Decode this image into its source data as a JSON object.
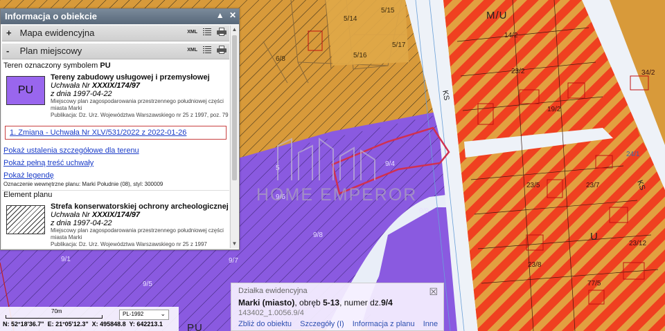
{
  "panel": {
    "title": "Informacja o obiekcie",
    "collapse_glyph": "▲",
    "close_glyph": "✕",
    "sections": [
      {
        "sign": "+",
        "label": "Mapa ewidencyjna",
        "xml": "XML"
      },
      {
        "sign": "-",
        "label": "Plan miejscowy",
        "xml": "XML"
      }
    ],
    "area_symbol_text": "Teren oznaczony symbolem",
    "area_symbol": "PU",
    "entry1": {
      "symbol": "PU",
      "title": "Tereny zabudowy usługowej i przemysłowej",
      "resolution_prefix": "Uchwała Nr",
      "resolution_no": "XXXIX/174/97",
      "date": "z dnia 1997-04-22",
      "desc": "Miejscowy plan zagospodarowania przestrzennego południowej części miasta Marki",
      "pub": "Publikacja: Dz. Urz. Województwa Warszawskiego nr 25 z 1997, poz. 79"
    },
    "change_link": "1. Zmiana - Uchwała Nr XLV/531/2022 z 2022-01-26",
    "links": [
      "Pokaż ustalenia szczegółowe dla terenu",
      "Pokaż pełną treść uchwały",
      "Pokaż legendę"
    ],
    "internal_designation": "Oznaczenie wewnętrzne planu: Marki Południe (08), styl: 300009",
    "element_heading": "Element planu",
    "entry2": {
      "title": "Strefa konserwatorskiej ochrony archeologicznej",
      "resolution_prefix": "Uchwała Nr",
      "resolution_no": "XXXIX/174/97",
      "date": "z dnia 1997-04-22",
      "desc": "Miejscowy plan zagospodarowania przestrzennego południowej części miasta Marki",
      "pub": "Publikacja: Dz. Urz. Województwa Warszawskiego nr 25 z 1997"
    }
  },
  "scale": {
    "label": "70m"
  },
  "crs": {
    "value": "PL-1992",
    "chevron": "⌄"
  },
  "coords": {
    "n": "N: 52°18'36.7\"",
    "e": "E: 21°05'12.3\"",
    "x": "X: 495848.8",
    "y": "Y: 642213.1"
  },
  "popup": {
    "title": "Działka ewidencyjna",
    "place": "Marki (miasto)",
    "mid1": ", obręb ",
    "obreb": "5-13",
    "mid2": ", numer dz.",
    "parcel": "9/4",
    "id": "143402_1.0056.9/4",
    "links": [
      "Zbliż do obiektu",
      "Szczegóły (I)",
      "Informacja z planu",
      "Inne"
    ],
    "close_glyph": "☒"
  },
  "watermark": "HOME EMPEROR",
  "map_labels": {
    "l1": "5/14",
    "l2": "5/15",
    "l3": "5/16",
    "l4": "5/17",
    "l5": "6/8",
    "l6": "9/6",
    "l7": "9/4",
    "l8": "9/9",
    "l9": "9/8",
    "l10": "9/7",
    "l11": "9/1",
    "l12": "9/5",
    "l13": "14/2",
    "l14": "23/2",
    "l15": "19/2",
    "l16": "23/7",
    "l17": "23/5",
    "l18": "23/8",
    "l19": "23/12",
    "l20": "77/5",
    "l21": "M/U",
    "l22": "KS",
    "l23": "KS",
    "l24": "U",
    "l25": "PU",
    "l26": "24/1",
    "l27": "34/2",
    "l28": "5"
  },
  "colors": {
    "pu_zone": "#8a5ae0",
    "mu_zone": "#f04020",
    "orange_zone": "#d89a3a",
    "parcel_highlight": "#d03050"
  }
}
